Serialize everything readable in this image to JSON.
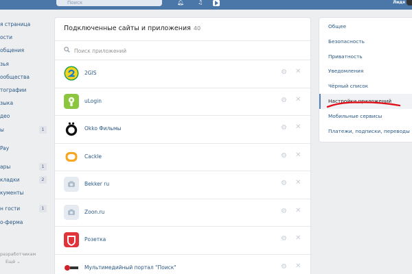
{
  "topbar": {
    "search_placeholder": "Поиск",
    "user_name": "Лидя"
  },
  "left_nav": {
    "items": [
      {
        "label": "я страница",
        "badge": ""
      },
      {
        "label": "ости",
        "badge": ""
      },
      {
        "label": "общения",
        "badge": ""
      },
      {
        "label": "зья",
        "badge": ""
      },
      {
        "label": "ообщества",
        "badge": ""
      },
      {
        "label": "тографии",
        "badge": ""
      },
      {
        "label": "зыка",
        "badge": ""
      },
      {
        "label": "део",
        "badge": ""
      },
      {
        "label": "ы",
        "badge": "1"
      },
      {
        "label": "Pay",
        "badge": ""
      },
      {
        "label": "ары",
        "badge": "1"
      },
      {
        "label": "кладки",
        "badge": "2"
      },
      {
        "label": "кументы",
        "badge": ""
      },
      {
        "label": "н гости",
        "badge": "1"
      },
      {
        "label": "о-ферма",
        "badge": ""
      }
    ],
    "footer_line1": "разработчикам",
    "footer_line2": "Ещё ⌄"
  },
  "main": {
    "title": "Подключенные сайты и приложения",
    "count": "40",
    "search_placeholder": "Поиск приложений",
    "apps": [
      {
        "name": "2GIS",
        "icon": "2gis-logo-icon"
      },
      {
        "name": "uLogin",
        "icon": "ulogin-logo-icon"
      },
      {
        "name": "Okko Фильмы",
        "icon": "okko-logo-icon"
      },
      {
        "name": "Cackle",
        "icon": "cackle-logo-icon"
      },
      {
        "name": "Bekker ru",
        "icon": "camera-placeholder-icon"
      },
      {
        "name": "Zoon.ru",
        "icon": "camera-placeholder-icon"
      },
      {
        "name": "Розетка",
        "icon": "rozetka-logo-icon"
      },
      {
        "name": "Мультимедийный портал \"Поиск\"",
        "icon": "poisk-logo-icon"
      }
    ]
  },
  "right_menu": {
    "items": [
      {
        "label": "Общее",
        "active": false
      },
      {
        "label": "Безопасность",
        "active": false
      },
      {
        "label": "Приватность",
        "active": false
      },
      {
        "label": "Уведомления",
        "active": false
      },
      {
        "label": "Чёрный список",
        "active": false
      },
      {
        "label": "Настройки приложений",
        "active": true
      },
      {
        "label": "Мобильные сервисы",
        "active": false
      },
      {
        "label": "Платежи, подписки, переводы",
        "active": false
      }
    ]
  },
  "colors": {
    "topbar": "#4a76a8",
    "link": "#2a5885",
    "background": "#edeef0",
    "annotation_red": "#e0101a"
  }
}
